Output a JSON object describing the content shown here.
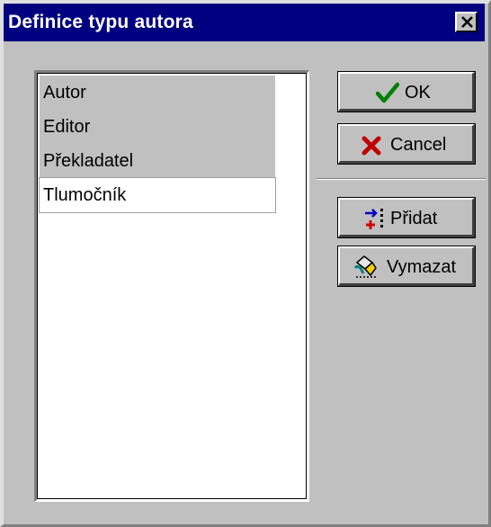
{
  "window": {
    "title": "Definice typu autora"
  },
  "list": {
    "items": [
      "Autor",
      "Editor",
      "Překladatel",
      "Tlumočník"
    ]
  },
  "buttons": {
    "ok": "OK",
    "cancel": "Cancel",
    "add": "Přidat",
    "delete": "Vymazat"
  },
  "icons": {
    "close": "close-icon",
    "ok": "checkmark-icon",
    "cancel": "red-x-icon",
    "add": "add-item-icon",
    "delete": "eraser-hand-icon"
  },
  "colors": {
    "titlebar": "#000080",
    "face": "#c0c0c0",
    "ok_check": "#008000",
    "cancel_x": "#c00000"
  }
}
